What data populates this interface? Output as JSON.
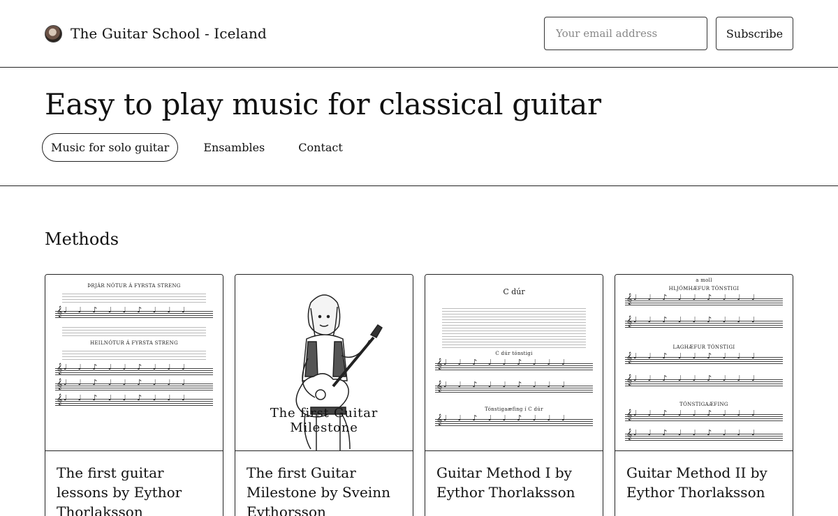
{
  "header": {
    "brand": "The Guitar School - Iceland",
    "email_placeholder": "Your email address",
    "subscribe_label": "Subscribe"
  },
  "hero": {
    "title": "Easy to play music for classical guitar",
    "nav": [
      "Music for solo guitar",
      "Ensambles",
      "Contact"
    ]
  },
  "section": {
    "title": "Methods"
  },
  "cards": [
    {
      "title": "The first guitar lessons by Eythor Thorlaksson",
      "thumb_lines": [
        "ÞRJÁR NÓTUR Á FYRSTA STRENG",
        "HEILNÓTUR Á FYRSTA STRENG"
      ]
    },
    {
      "title": "The first Guitar Milestone by Sveinn Eythorsson",
      "thumb_caption": "The first Guitar Milestone"
    },
    {
      "title": "Guitar Method I by Eythor Thorlaksson",
      "thumb_lines": [
        "C dúr",
        "C dúr tónstigi",
        "Tónstigaæfing í C dúr"
      ]
    },
    {
      "title": "Guitar Method II by Eythor Thorlaksson",
      "thumb_lines": [
        "a moll",
        "HLJÓMHÆFUR TÓNSTIGI",
        "LAGHÆFUR TÓNSTIGI",
        "TÓNSTIGAÆFING"
      ]
    }
  ],
  "icons": {
    "avatar": "avatar-photo",
    "clef": "treble-clef-icon"
  }
}
